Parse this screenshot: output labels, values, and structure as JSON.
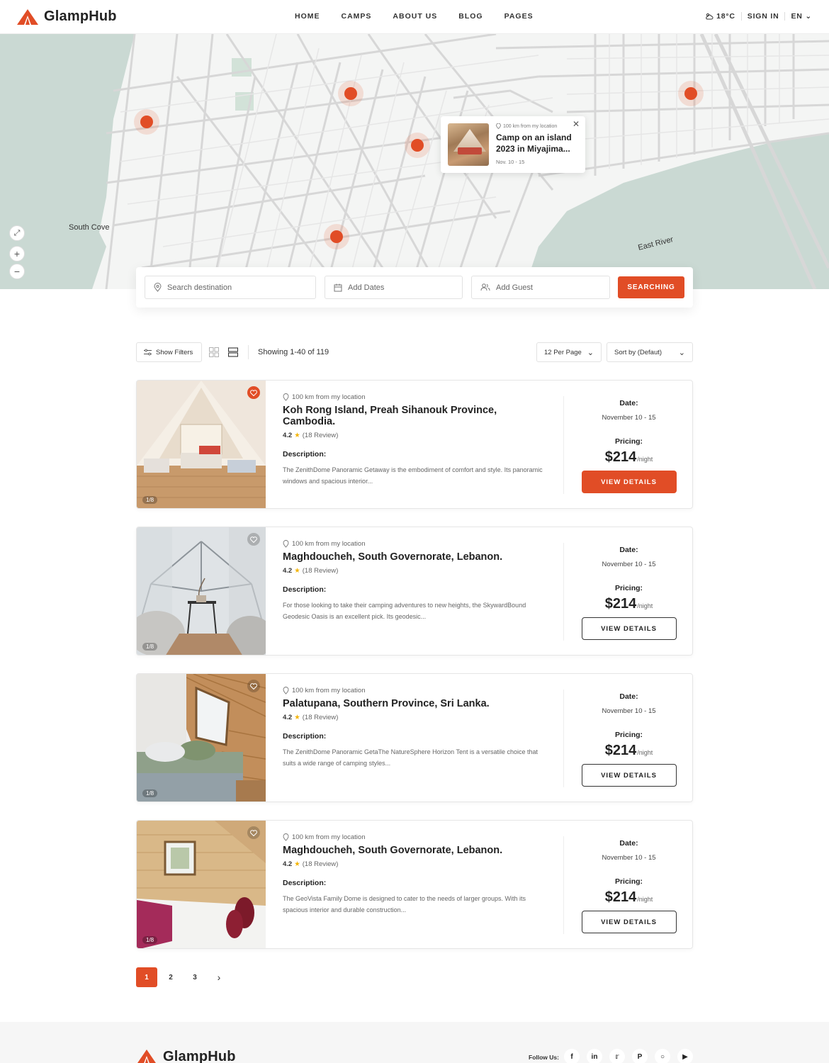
{
  "brand": {
    "name": "GlampHub",
    "accent": "#e14d26"
  },
  "nav": {
    "items": [
      "HOME",
      "CAMPS",
      "ABOUT US",
      "BLOG",
      "PAGES"
    ],
    "weather": "18°C",
    "sign_in": "SIGN IN",
    "language": "EN"
  },
  "map": {
    "labels": {
      "south_cove": "South Cove",
      "east_river": "East River"
    },
    "popup": {
      "distance": "100 km from my location",
      "title": "Camp on an island 2023 in Miyajima...",
      "date": "Nov. 10 - 15"
    }
  },
  "search": {
    "destination_placeholder": "Search destination",
    "dates_placeholder": "Add Dates",
    "guest_placeholder": "Add Guest",
    "button": "SEARCHING"
  },
  "toolbar": {
    "filters": "Show Filters",
    "showing": "Showing 1-40 of 119",
    "per_page": "12 Per Page",
    "sort": "Sort by (Defaut)"
  },
  "listings": [
    {
      "distance": "100 km from my location",
      "title": "Koh Rong Island, Preah Sihanouk Province, Cambodia.",
      "rating": "4.2",
      "reviews": "(18 Review)",
      "desc_label": "Description:",
      "description": "The ZenithDome Panoramic Getaway is the embodiment of comfort and style. Its panoramic windows and spacious interior...",
      "counter": "1/8",
      "date_label": "Date:",
      "date": "November 10 - 15",
      "pricing_label": "Pricing:",
      "price": "$214",
      "unit": "/night",
      "button": "VIEW DETAILS"
    },
    {
      "distance": "100 km from my location",
      "title": "Maghdoucheh, South Governorate, Lebanon.",
      "rating": "4.2",
      "reviews": "(18 Review)",
      "desc_label": "Description:",
      "description": "For those looking to take their camping adventures to new heights, the SkywardBound Geodesic Oasis is an excellent pick. Its geodesic...",
      "counter": "1/8",
      "date_label": "Date:",
      "date": "November 10 - 15",
      "pricing_label": "Pricing:",
      "price": "$214",
      "unit": "/night",
      "button": "VIEW DETAILS"
    },
    {
      "distance": "100 km from my location",
      "title": "Palatupana, Southern Province, Sri Lanka.",
      "rating": "4.2",
      "reviews": "(18 Review)",
      "desc_label": "Description:",
      "description": "The ZenithDome Panoramic GetaThe NatureSphere Horizon Tent is a versatile choice that suits a wide range of camping styles...",
      "counter": "1/8",
      "date_label": "Date:",
      "date": "November 10 - 15",
      "pricing_label": "Pricing:",
      "price": "$214",
      "unit": "/night",
      "button": "VIEW DETAILS"
    },
    {
      "distance": "100 km from my location",
      "title": "Maghdoucheh, South Governorate, Lebanon.",
      "rating": "4.2",
      "reviews": "(18 Review)",
      "desc_label": "Description:",
      "description": "The GeoVista Family Dome is designed to cater to the needs of larger groups. With its spacious interior and durable construction...",
      "counter": "1/8",
      "date_label": "Date:",
      "date": "November 10 - 15",
      "pricing_label": "Pricing:",
      "price": "$214",
      "unit": "/night",
      "button": "VIEW DETAILS"
    }
  ],
  "pagination": {
    "pages": [
      "1",
      "2",
      "3"
    ],
    "active": "1"
  },
  "footer": {
    "follow": "Follow Us:",
    "socials": [
      "f",
      "in",
      "tw",
      "p",
      "ig",
      "yt"
    ]
  }
}
